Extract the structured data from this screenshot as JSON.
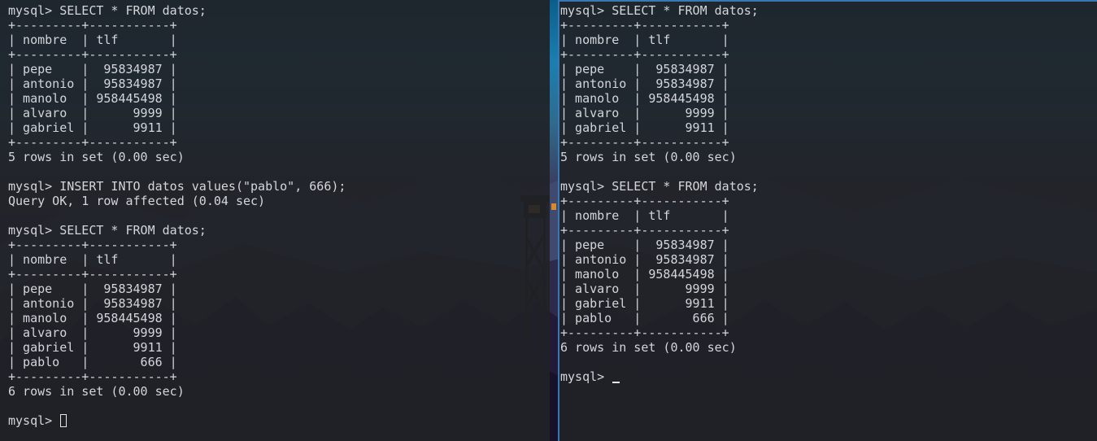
{
  "left_terminal": {
    "lines": [
      "mysql> SELECT * FROM datos;",
      "+---------+-----------+",
      "| nombre  | tlf       |",
      "+---------+-----------+",
      "| pepe    |  95834987 |",
      "| antonio |  95834987 |",
      "| manolo  | 958445498 |",
      "| alvaro  |      9999 |",
      "| gabriel |      9911 |",
      "+---------+-----------+",
      "5 rows in set (0.00 sec)",
      "",
      "mysql> INSERT INTO datos values(\"pablo\", 666);",
      "Query OK, 1 row affected (0.04 sec)",
      "",
      "mysql> SELECT * FROM datos;",
      "+---------+-----------+",
      "| nombre  | tlf       |",
      "+---------+-----------+",
      "| pepe    |  95834987 |",
      "| antonio |  95834987 |",
      "| manolo  | 958445498 |",
      "| alvaro  |      9999 |",
      "| gabriel |      9911 |",
      "| pablo   |       666 |",
      "+---------+-----------+",
      "6 rows in set (0.00 sec)",
      ""
    ],
    "prompt": "mysql> "
  },
  "right_terminal": {
    "lines": [
      "mysql> SELECT * FROM datos;",
      "+---------+-----------+",
      "| nombre  | tlf       |",
      "+---------+-----------+",
      "| pepe    |  95834987 |",
      "| antonio |  95834987 |",
      "| manolo  | 958445498 |",
      "| alvaro  |      9999 |",
      "| gabriel |      9911 |",
      "+---------+-----------+",
      "5 rows in set (0.00 sec)",
      "",
      "mysql> SELECT * FROM datos;",
      "+---------+-----------+",
      "| nombre  | tlf       |",
      "+---------+-----------+",
      "| pepe    |  95834987 |",
      "| antonio |  95834987 |",
      "| manolo  | 958445498 |",
      "| alvaro  |      9999 |",
      "| gabriel |      9911 |",
      "| pablo   |       666 |",
      "+---------+-----------+",
      "6 rows in set (0.00 sec)",
      ""
    ],
    "prompt": "mysql> "
  },
  "colors": {
    "terminal_bg": "#202227",
    "terminal_fg": "#d3d6da",
    "focus_border": "#3a78b5"
  }
}
